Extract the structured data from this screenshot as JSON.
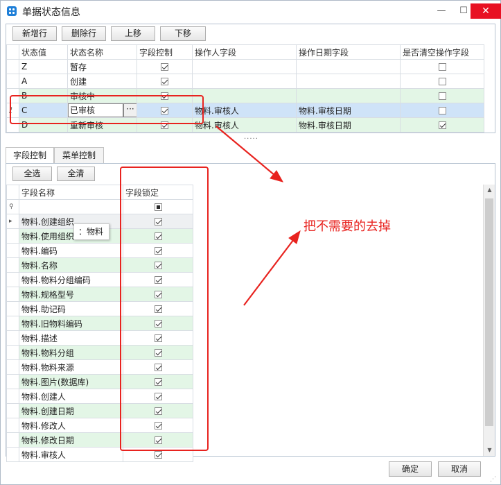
{
  "window": {
    "title": "单据状态信息",
    "min_icon": "minimize-icon",
    "max_icon": "maximize-icon",
    "close_icon": "close-icon"
  },
  "toolbar": {
    "add_row": "新增行",
    "delete_row": "删除行",
    "move_up": "上移",
    "move_down": "下移"
  },
  "status_table": {
    "columns": [
      "状态值",
      "状态名称",
      "字段控制",
      "操作人字段",
      "操作日期字段",
      "是否清空操作字段"
    ],
    "rows": [
      {
        "value": "Z",
        "name": "暂存",
        "field_control": true,
        "operator_field": "",
        "date_field": "",
        "clear_fields": false
      },
      {
        "value": "A",
        "name": "创建",
        "field_control": true,
        "operator_field": "",
        "date_field": "",
        "clear_fields": false
      },
      {
        "value": "B",
        "name": "审核中",
        "field_control": true,
        "operator_field": "",
        "date_field": "",
        "clear_fields": false
      },
      {
        "value": "C",
        "name": "已审核",
        "field_control": true,
        "operator_field": "物料.审核人",
        "date_field": "物料.审核日期",
        "clear_fields": false
      },
      {
        "value": "D",
        "name": "重新审核",
        "field_control": true,
        "operator_field": "物料.审核人",
        "date_field": "物料.审核日期",
        "clear_fields": true
      }
    ],
    "edit_marker": "ℓ",
    "ellipsis": "···"
  },
  "splitter": "·····",
  "tabs": [
    {
      "label": "字段控制",
      "active": true
    },
    {
      "label": "菜单控制",
      "active": false
    }
  ],
  "field_panel": {
    "select_all": "全选",
    "clear_all": "全清",
    "columns": [
      "字段名称",
      "字段锁定"
    ],
    "filter_icon": "filter-pin-icon",
    "row_pointer": "▸",
    "rows": [
      {
        "name": "物料.创建组织",
        "locked": true
      },
      {
        "name": "物料.使用组织",
        "locked": true
      },
      {
        "name": "物料.编码",
        "locked": true
      },
      {
        "name": "物料.名称",
        "locked": true
      },
      {
        "name": "物料.物料分组编码",
        "locked": true
      },
      {
        "name": "物料.规格型号",
        "locked": true
      },
      {
        "name": "物料.助记码",
        "locked": true
      },
      {
        "name": "物料.旧物料编码",
        "locked": true
      },
      {
        "name": "物料.描述",
        "locked": true
      },
      {
        "name": "物料.物料分组",
        "locked": true
      },
      {
        "name": "物料.物料来源",
        "locked": true
      },
      {
        "name": "物料.图片(数据库)",
        "locked": true
      },
      {
        "name": "物料.创建人",
        "locked": true
      },
      {
        "name": "物料.创建日期",
        "locked": true
      },
      {
        "name": "物料.修改人",
        "locked": true
      },
      {
        "name": "物料.修改日期",
        "locked": true
      },
      {
        "name": "物料.审核人",
        "locked": true
      }
    ]
  },
  "tooltip": "：物料",
  "annotation": {
    "text": "把不需要的去掉",
    "color": "#e8231f"
  },
  "footer": {
    "ok": "确定",
    "cancel": "取消"
  },
  "colors": {
    "row_green": "#e3f6e6",
    "row_selected": "#cfe3f8",
    "close_red": "#e81123",
    "accent": "#1e7fd8"
  }
}
